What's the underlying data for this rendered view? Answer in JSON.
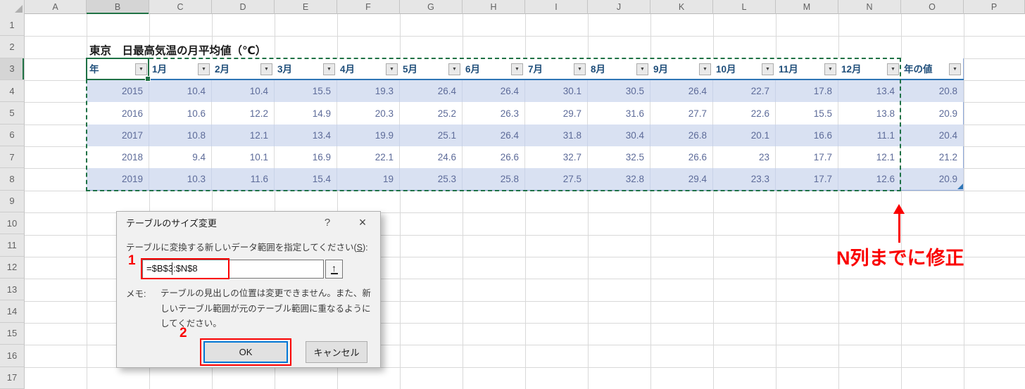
{
  "colors": {
    "excel_green": "#217346",
    "selection_green": "#1E7145",
    "table_header_text": "#1F4E7A",
    "table_data_text": "#5D6B99",
    "band_fill": "#D9E1F2",
    "header_underline_blue": "#2E75B6",
    "table_edge_blue": "#8EA9DB",
    "annotation_red": "#FA0000",
    "default_button_border": "#0078D7"
  },
  "spreadsheet": {
    "column_letters": [
      "A",
      "B",
      "C",
      "D",
      "E",
      "F",
      "G",
      "H",
      "I",
      "J",
      "K",
      "L",
      "M",
      "N",
      "O",
      "P"
    ],
    "selected_column": "B",
    "row_numbers": [
      "1",
      "2",
      "3",
      "4",
      "5",
      "6",
      "7",
      "8",
      "9",
      "10",
      "11",
      "12",
      "13",
      "14",
      "15",
      "16",
      "17"
    ],
    "selected_row": "3",
    "title": "東京　日最高気温の月平均値（℃）",
    "table": {
      "headers": [
        "年",
        "1月",
        "2月",
        "3月",
        "4月",
        "5月",
        "6月",
        "7月",
        "8月",
        "9月",
        "10月",
        "11月",
        "12月",
        "年の値"
      ],
      "rows": [
        [
          "2015",
          "10.4",
          "10.4",
          "15.5",
          "19.3",
          "26.4",
          "26.4",
          "30.1",
          "30.5",
          "26.4",
          "22.7",
          "17.8",
          "13.4",
          "20.8"
        ],
        [
          "2016",
          "10.6",
          "12.2",
          "14.9",
          "20.3",
          "25.2",
          "26.3",
          "29.7",
          "31.6",
          "27.7",
          "22.6",
          "15.5",
          "13.8",
          "20.9"
        ],
        [
          "2017",
          "10.8",
          "12.1",
          "13.4",
          "19.9",
          "25.1",
          "26.4",
          "31.8",
          "30.4",
          "26.8",
          "20.1",
          "16.6",
          "11.1",
          "20.4"
        ],
        [
          "2018",
          "9.4",
          "10.1",
          "16.9",
          "22.1",
          "24.6",
          "26.6",
          "32.7",
          "32.5",
          "26.6",
          "23",
          "17.7",
          "12.1",
          "21.2"
        ],
        [
          "2019",
          "10.3",
          "11.6",
          "15.4",
          "19",
          "25.3",
          "25.8",
          "27.5",
          "32.8",
          "29.4",
          "23.3",
          "17.7",
          "12.6",
          "20.9"
        ]
      ]
    }
  },
  "dialog": {
    "title": "テーブルのサイズ変更",
    "prompt_pre": "テーブルに変換する新しいデータ範囲を指定してください(",
    "access_key": "S",
    "prompt_post": "):",
    "range_value": "=$B$3:$N$8",
    "memo_label": "メモ:",
    "memo_text": "テーブルの見出しの位置は変更できません。また、新しいテーブル範囲が元のテーブル範囲に重なるようにしてください。",
    "ok_label": "OK",
    "cancel_label": "キャンセル",
    "icons": {
      "help": "?",
      "close": "×",
      "picker": "↑",
      "filter": "▼"
    }
  },
  "annotations": {
    "step1": "1",
    "step2": "2",
    "note": "N列までに修正"
  }
}
